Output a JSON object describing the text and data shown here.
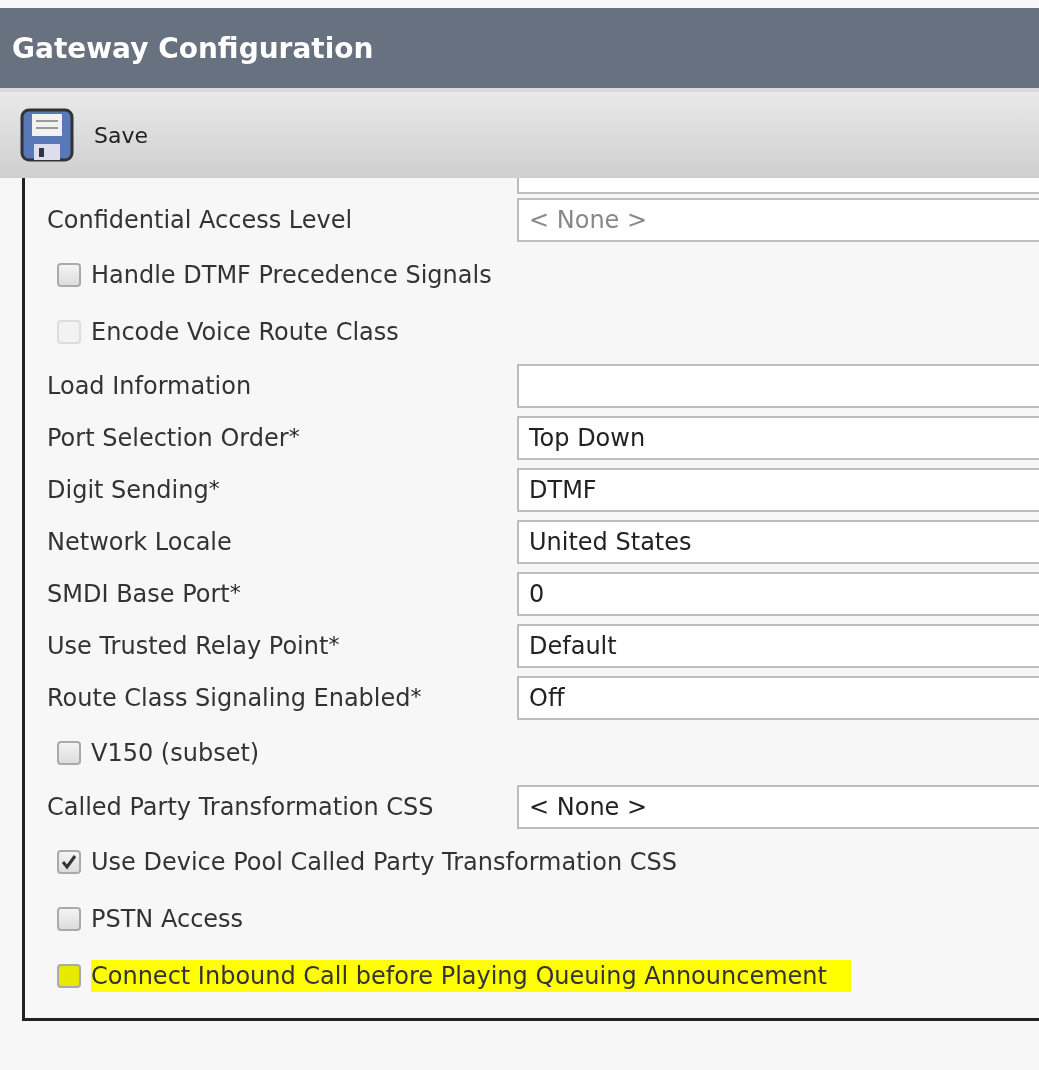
{
  "window": {
    "title": "Gateway Configuration"
  },
  "toolbar": {
    "buttons": [
      {
        "label": "Save",
        "kind": "save"
      }
    ]
  },
  "form": {
    "rows": [
      {
        "kind": "partial"
      },
      {
        "kind": "select",
        "label": "Confidential Access Level",
        "placeholder": "< None >"
      },
      {
        "kind": "checkbox",
        "label": "Handle DTMF Precedence Signals",
        "checked": false,
        "disabled": false
      },
      {
        "kind": "checkbox",
        "label": "Encode Voice Route Class",
        "checked": false,
        "disabled": true
      },
      {
        "kind": "text",
        "label": "Load Information"
      },
      {
        "kind": "select",
        "label": "Port Selection Order",
        "mark": "*",
        "value": "Top Down"
      },
      {
        "kind": "select",
        "label": "Digit Sending",
        "mark": "*",
        "value": "DTMF"
      },
      {
        "kind": "select",
        "label": "Network Locale",
        "value": "United States"
      },
      {
        "kind": "text",
        "label": "SMDI Base Port",
        "mark": "*",
        "value": "0"
      },
      {
        "kind": "select",
        "label": "Use Trusted Relay Point",
        "mark": "*",
        "value": "Default"
      },
      {
        "kind": "select",
        "label": "Route Class Signaling Enabled",
        "mark": "*",
        "value": "Off"
      },
      {
        "kind": "checkbox",
        "label": "V150 (subset)",
        "checked": false,
        "disabled": false
      },
      {
        "kind": "select",
        "label": "Called Party Transformation CSS",
        "value": "< None >"
      },
      {
        "kind": "checkbox",
        "label": "Use Device Pool Called Party Transformation CSS",
        "checked": true,
        "disabled": false
      },
      {
        "kind": "checkbox",
        "label": "PSTN Access",
        "checked": false,
        "disabled": false
      },
      {
        "kind": "checkbox",
        "label": "Connect Inbound Call before Playing Queuing Announcement",
        "checked": false,
        "disabled": false,
        "highlighted": true
      }
    ]
  }
}
